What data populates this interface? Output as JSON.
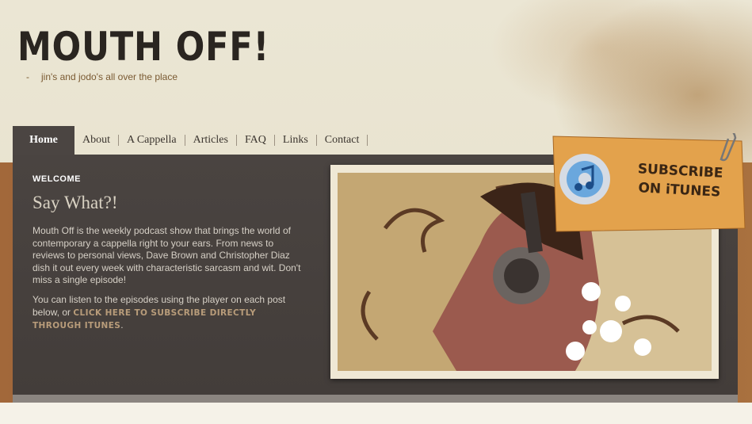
{
  "site": {
    "logo": "MOUTH OFF!",
    "tagline": "jin's and jodo's all over the place"
  },
  "nav": {
    "home": "Home",
    "items": [
      "About",
      "A Cappella",
      "Articles",
      "FAQ",
      "Links",
      "Contact"
    ]
  },
  "main": {
    "section_label": "WELCOME",
    "heading": "Say What?!",
    "intro": "Mouth Off is the weekly podcast show that brings the world of contemporary a cappella right to your ears.  From news to reviews to personal views, Dave Brown and Christopher Diaz dish it out every week with characteristic sarcasm and wit. Don't miss a single episode!",
    "listen_prefix": "You can listen to the episodes using the player on each post below, or ",
    "subscribe_link": "CLICK HERE TO SUBSCRIBE DIRECTLY THROUGH ITUNES",
    "listen_suffix": "."
  },
  "subscribe_tag": {
    "line1": "SUBSCRIBE",
    "line2": "ON iTUNES",
    "icon": "itunes-icon"
  },
  "colors": {
    "panel": "#4a4441",
    "accent": "#b89c7a",
    "tag": "#e3a24c"
  }
}
